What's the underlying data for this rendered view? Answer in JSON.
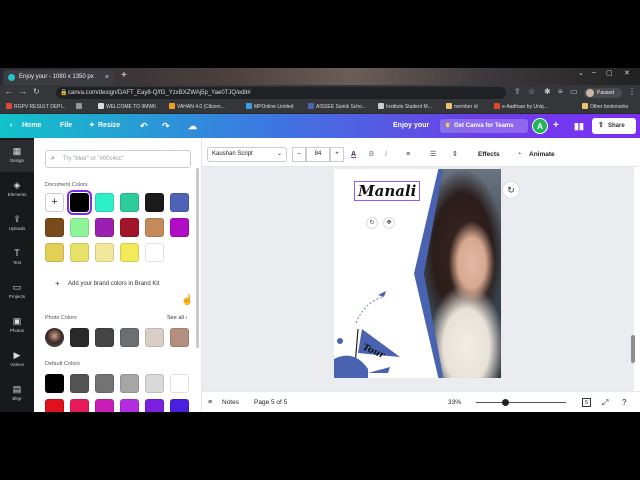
{
  "browser": {
    "tab_title": "Enjoy your - 1080 x 1350 px",
    "tab_close": "×",
    "new_tab": "+",
    "window_controls": [
      "⌄",
      "–",
      "▢",
      "✕"
    ],
    "url": "canva.com/design/DAFT_Eay8-Q/fG_YzxBXZWAj5p_Yae0TJQ/edit#",
    "profile_status": "Paused",
    "bookmarks": [
      "RGPV RESULT DEPI...",
      "",
      "WELCOME TO IIMWII",
      "VAHAN 4.0 (Citizen...",
      "MPOnline Limited",
      "AISSEE Sainik Scho...",
      "Institute Student M...",
      "member id",
      "e-Aadhaar by Uniq...",
      "Other bookmarks"
    ]
  },
  "topbar": {
    "home": "Home",
    "file": "File",
    "resize": "Resize",
    "doc_title": "Enjoy your",
    "teams_button": "Get Canva for Teams",
    "avatar_initial": "A",
    "add": "+",
    "share": "Share"
  },
  "rail": [
    "Design",
    "Elements",
    "Uploads",
    "Text",
    "Projects",
    "Photos",
    "Videos",
    "Bkgr"
  ],
  "panel": {
    "search_placeholder": "Try \"blue\" or \"#00c4cc\"",
    "document_colors_title": "Document Colors",
    "document_colors": [
      "#000000",
      "#2ef0c8",
      "#2ecc9a",
      "#1a1a1a",
      "#4e62b8",
      "#7a4a1c",
      "#8ef59a",
      "#9b1fb0",
      "#a3142a",
      "#c48a5a",
      "#b10dc4",
      "#e3cf55",
      "#e6e36a",
      "#f2e79a",
      "#f3ea5a",
      "#ffffff"
    ],
    "brand_link": "Add your brand colors in Brand Kit",
    "photo_colors_title": "Photo Colors",
    "see_all": "See all ›",
    "photo_colors": [
      "#2a2a2a",
      "#454545",
      "#6b6f72",
      "#d9cfc6",
      "#b48e7e"
    ],
    "default_colors_title": "Default Colors",
    "default_colors_row1": [
      "#000000",
      "#545454",
      "#737373",
      "#a6a6a6",
      "#d9d9d9",
      "#ffffff"
    ],
    "default_colors_row2": [
      "#e0101f",
      "#e61b5c",
      "#c71fb5",
      "#b32ee0",
      "#7b1fe0",
      "#4a1fe0"
    ]
  },
  "toolbar": {
    "font": "Kaushan Script",
    "font_size": "84",
    "minus": "–",
    "plus": "+",
    "text_color_icon": "A",
    "bold": "B",
    "italic": "I",
    "effects": "Effects",
    "animate": "Animate"
  },
  "canvas": {
    "heading": "Manali",
    "tour_label": "Tour"
  },
  "bottombar": {
    "notes": "Notes",
    "page": "Page 5 of 5",
    "zoom": "33%",
    "page_count": "5"
  },
  "colors": {
    "accent": "#7d2ae8",
    "frame_blue": "#4a63b0"
  }
}
